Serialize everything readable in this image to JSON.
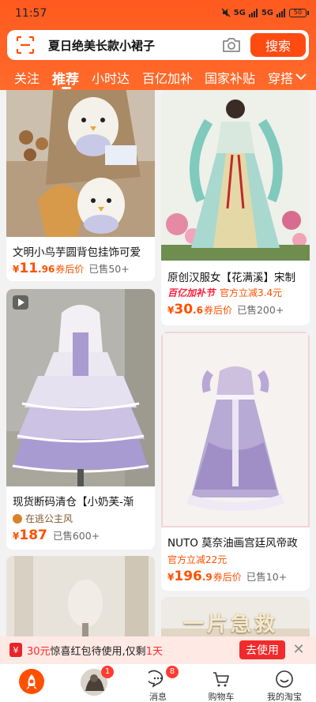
{
  "status": {
    "time": "11:57",
    "signal1": "5G",
    "signal2": "5G",
    "battery": "50"
  },
  "search": {
    "query": "夏日绝美长款小裙子",
    "button": "搜索"
  },
  "tabs": [
    {
      "label": "关注"
    },
    {
      "label": "推荐"
    },
    {
      "label": "小时达"
    },
    {
      "label": "百亿加补"
    },
    {
      "label": "国家补贴"
    },
    {
      "label": "穿搭"
    }
  ],
  "feed": {
    "left": [
      {
        "title": "文明小鸟芋圆背包挂饰可爱",
        "price_int": "11",
        "price_dec": ".96",
        "price_tag": "券后价",
        "sold": "已售50+"
      },
      {
        "title": "现货断码清仓【小奶芙-渐",
        "shop": "在逃公主风",
        "price_int": "187",
        "price_dec": "",
        "price_tag": "",
        "sold": "已售600+"
      },
      {
        "title": ""
      }
    ],
    "right": [
      {
        "title": "原创汉服女【花满溪】宋制",
        "badge": "百亿加补节",
        "promo": "官方立减3.4元",
        "price_int": "30",
        "price_dec": ".6",
        "price_tag": "券后价",
        "sold": "已售200+"
      },
      {
        "title": "NUTO 莫奈油画宫廷风帝政",
        "promo": "官方立减22元",
        "price_int": "196",
        "price_dec": ".9",
        "price_tag": "券后价",
        "sold": "已售10+"
      },
      {
        "banner_text": "一片急救"
      }
    ]
  },
  "coupon": {
    "amount": "30元",
    "text": "惊喜红包待使用,仅剩",
    "days": "1天",
    "button": "去使用",
    "icon_text": "¥"
  },
  "nav": {
    "home": "",
    "feed_badge": "1",
    "messages": "消息",
    "messages_badge": "8",
    "cart": "购物车",
    "mine": "我的淘宝"
  },
  "colors": {
    "accent": "#ff5000",
    "header": "#ff5a1f",
    "coupon_button": "#f02b2b"
  }
}
